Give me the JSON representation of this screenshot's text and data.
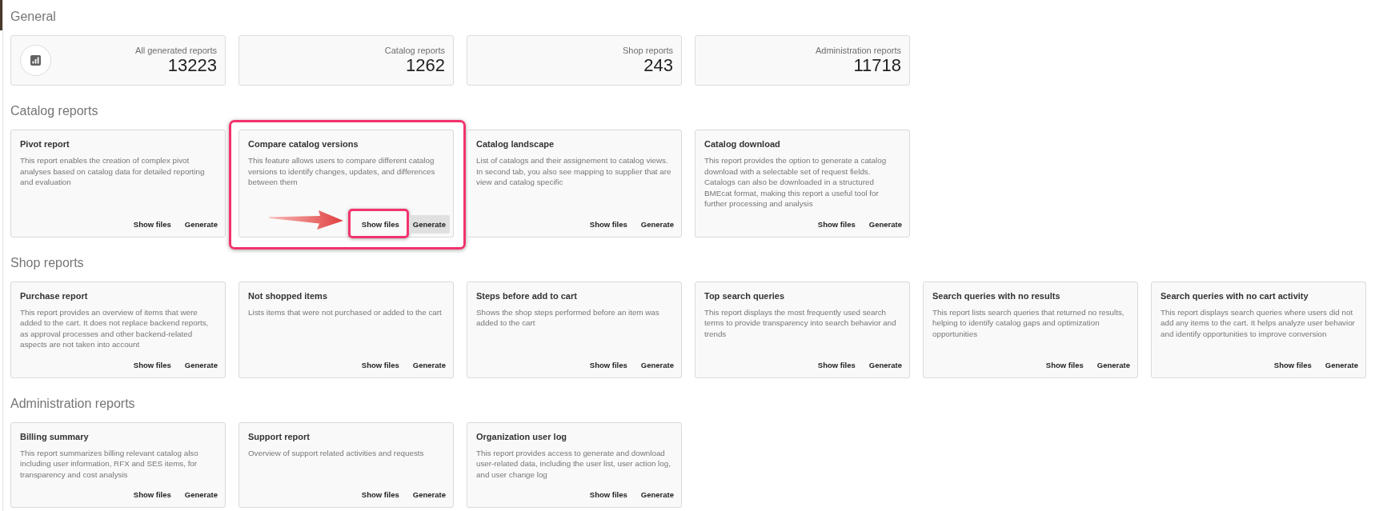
{
  "general": {
    "title": "General",
    "stats": [
      {
        "kind": "total",
        "label": "All generated reports",
        "value": "13223"
      },
      {
        "kind": "category",
        "label": "Catalog reports",
        "value": "1262"
      },
      {
        "kind": "category",
        "label": "Shop reports",
        "value": "243"
      },
      {
        "kind": "category",
        "label": "Administration reports",
        "value": "11718"
      }
    ]
  },
  "report_sections": [
    {
      "title": "Catalog reports",
      "reports": [
        {
          "title": "Pivot report",
          "description": "This report enables the creation of complex pivot analyses based on catalog data for detailed reporting and evaluation",
          "highlighted": false,
          "buttons": [
            {
              "label": "Show files",
              "highlighted": false,
              "hovered": false
            },
            {
              "label": "Generate",
              "highlighted": false,
              "hovered": false
            }
          ]
        },
        {
          "title": "Compare catalog versions",
          "description": "This feature allows users to compare different catalog versions to identify changes, updates, and differences between them",
          "highlighted": true,
          "buttons": [
            {
              "label": "Show files",
              "highlighted": true,
              "hovered": false
            },
            {
              "label": "Generate",
              "highlighted": false,
              "hovered": true
            }
          ]
        },
        {
          "title": "Catalog landscape",
          "description": "List of catalogs and their assignement to catalog views. In second tab, you also see mapping to supplier that are view and catalog specific",
          "highlighted": false,
          "buttons": [
            {
              "label": "Show files",
              "highlighted": false,
              "hovered": false
            },
            {
              "label": "Generate",
              "highlighted": false,
              "hovered": false
            }
          ]
        },
        {
          "title": "Catalog download",
          "description": "This report provides the option to generate a catalog download with a selectable set of request fields. Catalogs can also be downloaded in a structured BMEcat format, making this report a useful tool for further processing and analysis",
          "highlighted": false,
          "buttons": [
            {
              "label": "Show files",
              "highlighted": false,
              "hovered": false
            },
            {
              "label": "Generate",
              "highlighted": false,
              "hovered": false
            }
          ]
        }
      ]
    },
    {
      "title": "Shop reports",
      "reports": [
        {
          "title": "Purchase report",
          "description": "This report provides an overview of items that were added to the cart. It does not replace backend reports, as approval processes and other backend-related aspects are not taken into account",
          "highlighted": false,
          "buttons": [
            {
              "label": "Show files",
              "highlighted": false,
              "hovered": false
            },
            {
              "label": "Generate",
              "highlighted": false,
              "hovered": false
            }
          ]
        },
        {
          "title": "Not shopped items",
          "description": "Lists items that were not purchased or added to the cart",
          "highlighted": false,
          "buttons": [
            {
              "label": "Show files",
              "highlighted": false,
              "hovered": false
            },
            {
              "label": "Generate",
              "highlighted": false,
              "hovered": false
            }
          ]
        },
        {
          "title": "Steps before add to cart",
          "description": "Shows the shop steps performed before an item was added to the cart",
          "highlighted": false,
          "buttons": [
            {
              "label": "Show files",
              "highlighted": false,
              "hovered": false
            },
            {
              "label": "Generate",
              "highlighted": false,
              "hovered": false
            }
          ]
        },
        {
          "title": "Top search queries",
          "description": "This report displays the most frequently used search terms to provide transparency into search behavior and trends",
          "highlighted": false,
          "buttons": [
            {
              "label": "Show files",
              "highlighted": false,
              "hovered": false
            },
            {
              "label": "Generate",
              "highlighted": false,
              "hovered": false
            }
          ]
        },
        {
          "title": "Search queries with no results",
          "description": "This report lists search queries that returned no results, helping to identify catalog gaps and optimization opportunities",
          "highlighted": false,
          "buttons": [
            {
              "label": "Show files",
              "highlighted": false,
              "hovered": false
            },
            {
              "label": "Generate",
              "highlighted": false,
              "hovered": false
            }
          ]
        },
        {
          "title": "Search queries with no cart activity",
          "description": "This report displays search queries where users did not add any items to the cart. It helps analyze user behavior and identify opportunities to improve conversion",
          "highlighted": false,
          "buttons": [
            {
              "label": "Show files",
              "highlighted": false,
              "hovered": false
            },
            {
              "label": "Generate",
              "highlighted": false,
              "hovered": false
            }
          ]
        }
      ]
    },
    {
      "title": "Administration reports",
      "reports": [
        {
          "title": "Billing summary",
          "description": "This report summarizes billing relevant catalog also including user information, RFX and SES items, for transparency and cost analysis",
          "highlighted": false,
          "buttons": [
            {
              "label": "Show files",
              "highlighted": false,
              "hovered": false
            },
            {
              "label": "Generate",
              "highlighted": false,
              "hovered": false
            }
          ]
        },
        {
          "title": "Support report",
          "description": "Overview of support related activities and requests",
          "highlighted": false,
          "buttons": [
            {
              "label": "Show files",
              "highlighted": false,
              "hovered": false
            },
            {
              "label": "Generate",
              "highlighted": false,
              "hovered": false
            }
          ]
        },
        {
          "title": "Organization user log",
          "description": "This report provides access to generate and download user-related data, including the user list, user action log, and user change log",
          "highlighted": false,
          "buttons": [
            {
              "label": "Show files",
              "highlighted": false,
              "hovered": false
            },
            {
              "label": "Generate",
              "highlighted": false,
              "hovered": false
            }
          ]
        }
      ]
    }
  ]
}
